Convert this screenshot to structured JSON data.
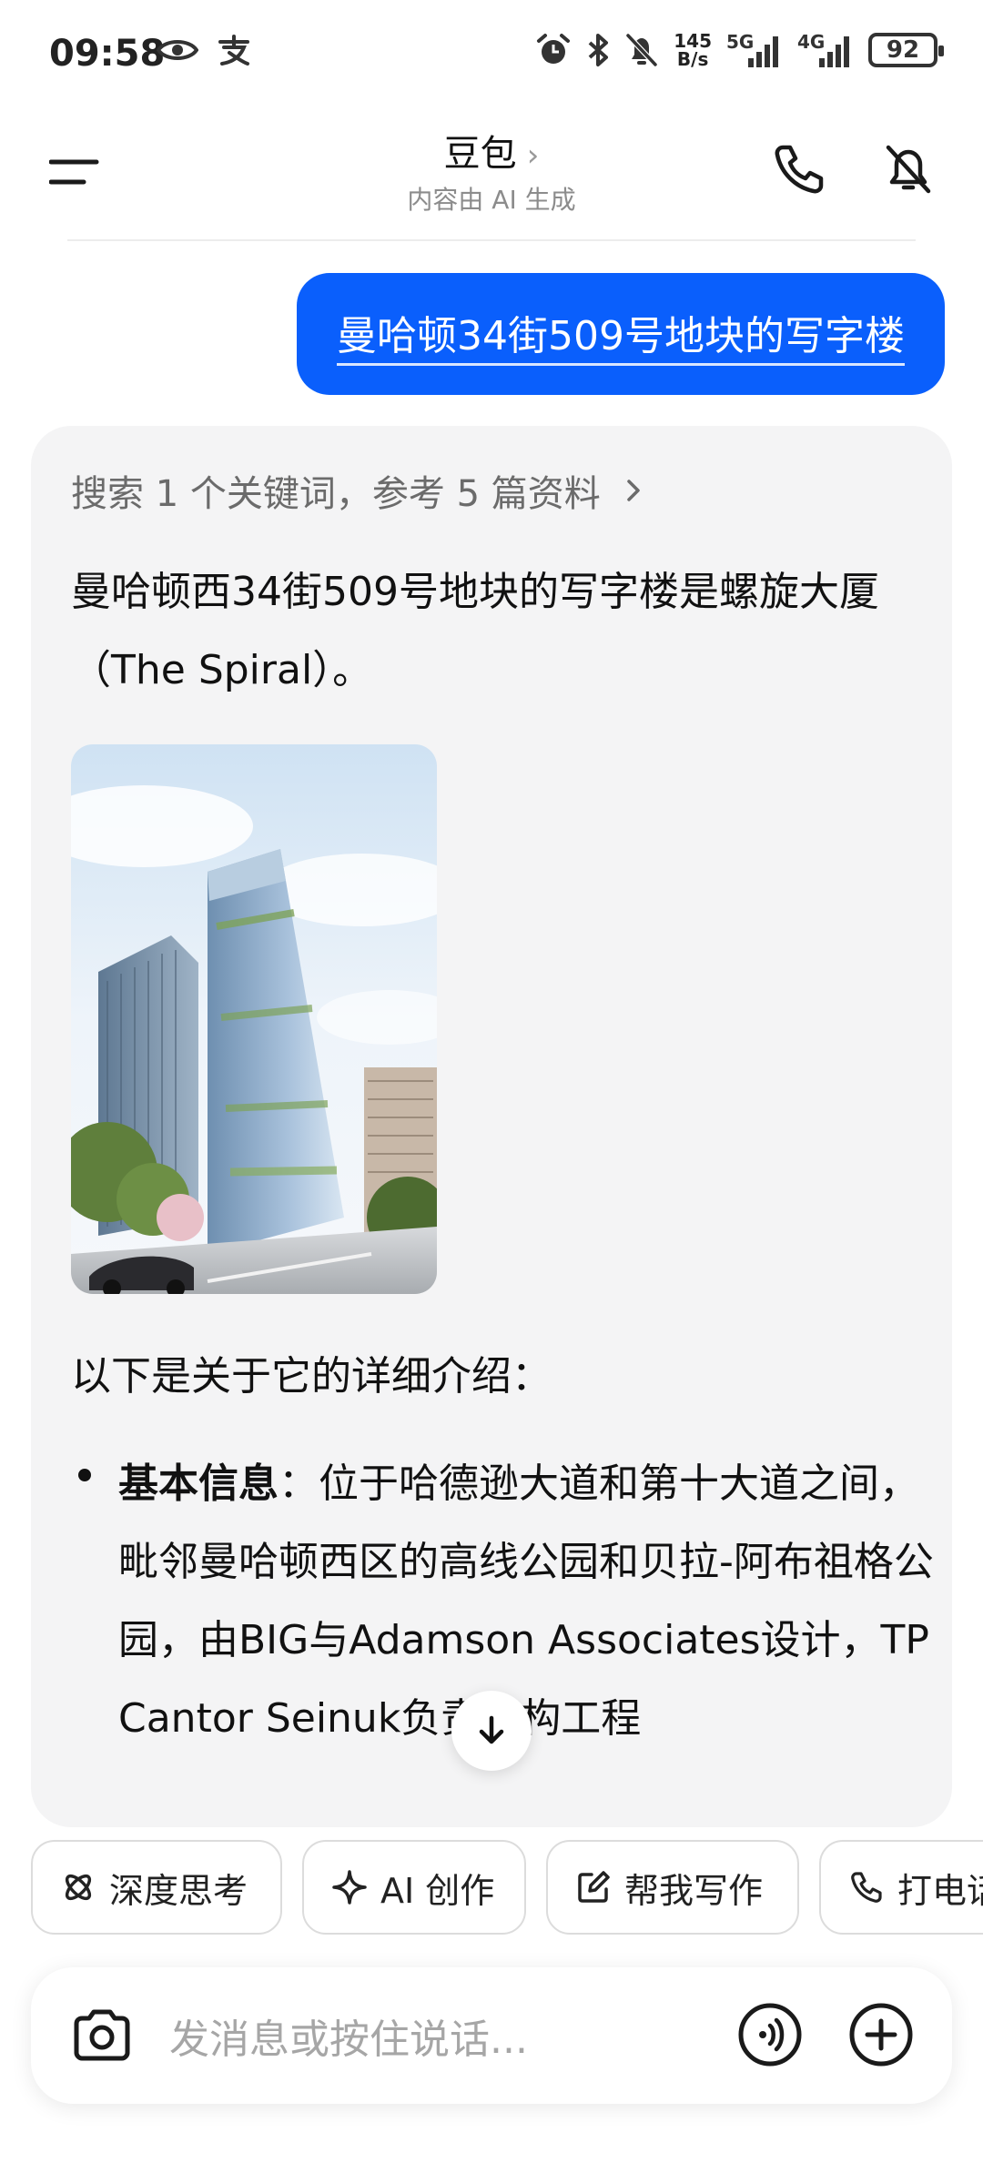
{
  "status_bar": {
    "time": "09:58",
    "net_speed_top": "145",
    "net_speed_bottom": "B/s",
    "net_5g": "5G",
    "net_4g": "4G",
    "battery": "92"
  },
  "header": {
    "title": "豆包",
    "subtitle": "内容由 AI 生成"
  },
  "user_message": "曼哈顿34街509号地块的写字楼",
  "ai_response": {
    "search_ref": "搜索 1 个关键词，参考 5 篇资料",
    "answer": "曼哈顿西34街509号地块的写字楼是螺旋大厦（The Spiral）。",
    "intro": "以下是关于它的详细介绍：",
    "bullet_label": "基本信息",
    "bullet_text": "：位于哈德逊大道和第十大道之间，毗邻曼哈顿西区的高线公园和贝拉-阿布祖格公园，由BIG与Adamson Associates设计，TP Cantor Seinuk负责结构工程"
  },
  "chips": [
    {
      "label": "深度思考",
      "icon": "deep-think-icon"
    },
    {
      "label": "AI 创作",
      "icon": "sparkle-icon"
    },
    {
      "label": "帮我写作",
      "icon": "edit-icon"
    },
    {
      "label": "打电话",
      "icon": "phone-icon"
    }
  ],
  "input": {
    "placeholder": "发消息或按住说话..."
  },
  "colors": {
    "accent": "#0a5ffc",
    "card_bg": "#f4f4f5"
  }
}
